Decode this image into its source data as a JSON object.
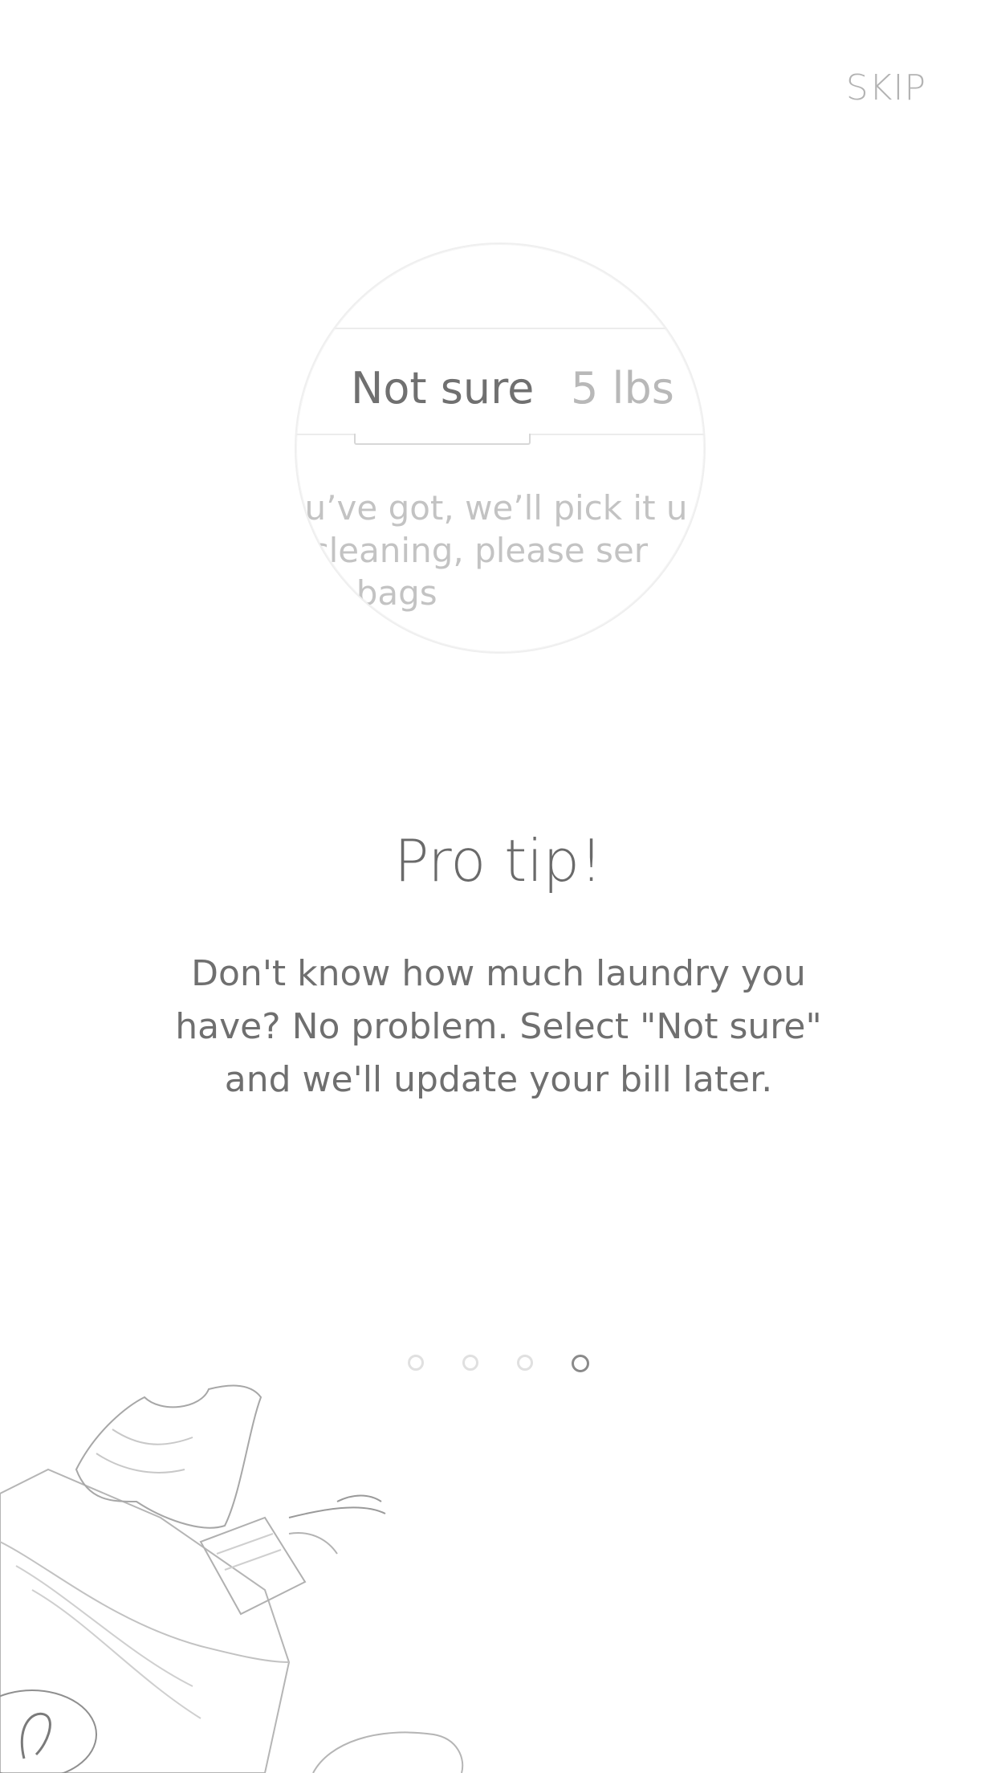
{
  "header": {
    "skip_label": "SKIP"
  },
  "magnifier": {
    "options": {
      "selected": "Not sure",
      "next": "5 lbs"
    },
    "description_lines": [
      "you’ve got, we’ll pick it u",
      "ry cleaning, please ser",
      "ndry bags"
    ]
  },
  "tip": {
    "title": "Pro tip!",
    "body": "Don't know how much laundry you have? No problem. Select \"Not sure\" and we'll update your bill later."
  },
  "pagination": {
    "total": 4,
    "active_index": 3
  },
  "illustration": {
    "icon": "laundry-bag-icon",
    "logo_letter": "d"
  }
}
